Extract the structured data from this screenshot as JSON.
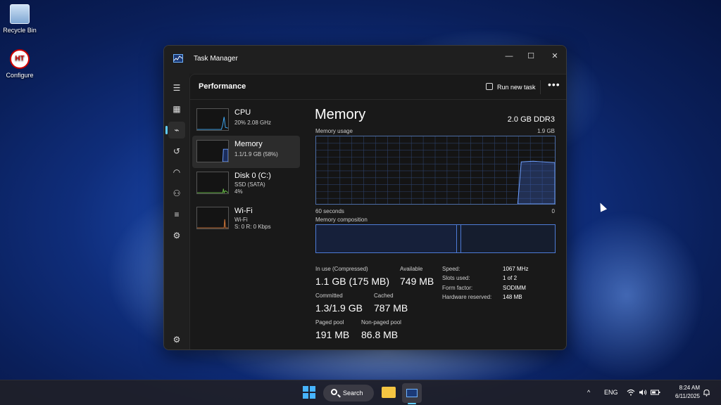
{
  "desktop": {
    "icons": [
      {
        "label": "Recycle Bin",
        "icon": "recycle-bin-icon"
      },
      {
        "label": "Configure",
        "icon": "configure-icon",
        "badge": "HT"
      }
    ]
  },
  "window": {
    "title": "Task Manager",
    "controls": {
      "minimize": "—",
      "maximize": "☐",
      "close": "✕"
    }
  },
  "toolbar": {
    "page_title": "Performance",
    "run_new_task": "Run new task",
    "more": "•••"
  },
  "nav": {
    "items": [
      {
        "name": "hamburger-menu-icon",
        "glyph": "☰"
      },
      {
        "name": "processes-icon",
        "glyph": "▦"
      },
      {
        "name": "performance-icon",
        "glyph": "⌁"
      },
      {
        "name": "app-history-icon",
        "glyph": "↺"
      },
      {
        "name": "startup-apps-icon",
        "glyph": "◠"
      },
      {
        "name": "users-icon",
        "glyph": "⚇"
      },
      {
        "name": "details-icon",
        "glyph": "≡"
      },
      {
        "name": "services-icon",
        "glyph": "⚙"
      }
    ],
    "settings_glyph": "⚙"
  },
  "perf_list": [
    {
      "name": "CPU",
      "line1": "20%  2.08 GHz",
      "line2": ""
    },
    {
      "name": "Memory",
      "line1": "1.1/1.9 GB (58%)",
      "line2": ""
    },
    {
      "name": "Disk 0 (C:)",
      "line1": "SSD (SATA)",
      "line2": "4%"
    },
    {
      "name": "Wi-Fi",
      "line1": "Wi-Fi",
      "line2": "S: 0  R: 0 Kbps"
    }
  ],
  "detail": {
    "title": "Memory",
    "spec": "2.0 GB DDR3",
    "usage_label": "Memory usage",
    "usage_max": "1.9 GB",
    "time_left": "60 seconds",
    "time_right": "0",
    "composition_label": "Memory composition",
    "stats": {
      "in_use_label": "In use (Compressed)",
      "in_use_value": "1.1 GB (175 MB)",
      "available_label": "Available",
      "available_value": "749 MB",
      "committed_label": "Committed",
      "committed_value": "1.3/1.9 GB",
      "cached_label": "Cached",
      "cached_value": "787 MB",
      "paged_label": "Paged pool",
      "paged_value": "191 MB",
      "nonpaged_label": "Non-paged pool",
      "nonpaged_value": "86.8 MB"
    },
    "specs": [
      {
        "label": "Speed:",
        "value": "1067 MHz"
      },
      {
        "label": "Slots used:",
        "value": "1 of 2"
      },
      {
        "label": "Form factor:",
        "value": "SODIMM"
      },
      {
        "label": "Hardware reserved:",
        "value": "148 MB"
      }
    ]
  },
  "taskbar": {
    "search_label": "Search",
    "tray_chevron": "^",
    "language": "ENG",
    "time": "8:24 AM",
    "date": "6/11/2025"
  },
  "colors": {
    "accent": "#60cdff",
    "graph_line": "#6fa0ff",
    "window_bg": "#1c1c1c"
  }
}
